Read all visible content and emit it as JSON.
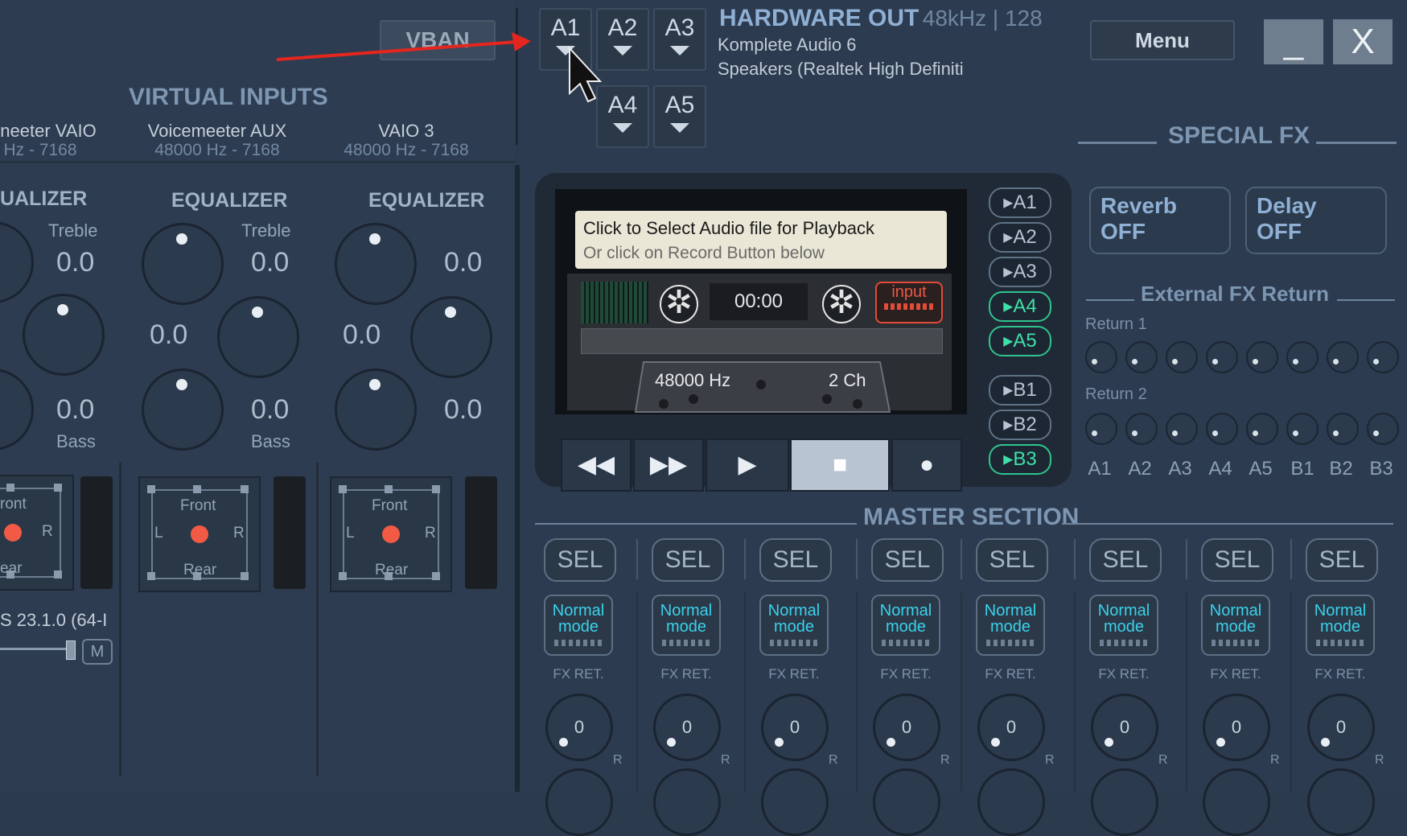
{
  "vban": {
    "label": "VBAN"
  },
  "hardware_out": {
    "title": "HARDWARE OUT",
    "rate": "48kHz | 128",
    "device1": "Komplete Audio 6",
    "device2": "Speakers (Realtek High Definiti"
  },
  "out_buttons": [
    "A1",
    "A2",
    "A3",
    "A4",
    "A5"
  ],
  "menu": {
    "label": "Menu"
  },
  "window": {
    "minimize": "_",
    "close": "X"
  },
  "virtual_inputs": {
    "title": "VIRTUAL INPUTS",
    "strips": [
      {
        "name": "neeter VAIO",
        "rate": "Hz - 7168"
      },
      {
        "name": "Voicemeeter AUX",
        "rate": "48000 Hz - 7168"
      },
      {
        "name": "VAIO 3",
        "rate": "48000 Hz - 7168"
      }
    ]
  },
  "equalizers": [
    {
      "title": "UALIZER",
      "treble_label": "Treble",
      "treble": "0.0",
      "mid": "",
      "bass": "0.0",
      "bass_label": "Bass"
    },
    {
      "title": "EQUALIZER",
      "treble_label": "Treble",
      "treble": "0.0",
      "mid": "0.0",
      "bass": "0.0",
      "bass_label": "Bass"
    },
    {
      "title": "EQUALIZER",
      "treble_label": "",
      "treble": "0.0",
      "mid": "0.0",
      "bass": "0.0",
      "bass_label": ""
    }
  ],
  "pan_pads": [
    {
      "top": "ront",
      "left": "",
      "right": "R",
      "bottom": "ear"
    },
    {
      "top": "Front",
      "left": "L",
      "right": "R",
      "bottom": "Rear"
    },
    {
      "top": "Front",
      "left": "L",
      "right": "R",
      "bottom": "Rear"
    }
  ],
  "left_footer": {
    "version": "S 23.1.0 (64-I",
    "mute": "M"
  },
  "recorder": {
    "msg1": "Click to Select Audio file for Playback",
    "msg2": "Or click on Record Button below",
    "time": "00:00",
    "input": "input",
    "rate": "48000 Hz",
    "channels": "2 Ch",
    "bus_buttons": [
      "A1",
      "A2",
      "A3",
      "A4",
      "A5",
      "B1",
      "B2",
      "B3"
    ],
    "bus_active": [
      false,
      false,
      false,
      true,
      true,
      false,
      false,
      true
    ]
  },
  "special_fx": {
    "title": "SPECIAL FX",
    "reverb": {
      "name": "Reverb",
      "state": "OFF"
    },
    "delay": {
      "name": "Delay",
      "state": "OFF"
    },
    "ext_title": "External FX Return",
    "return1": "Return 1",
    "return2": "Return 2",
    "bus_labels": [
      "A1",
      "A2",
      "A3",
      "A4",
      "A5",
      "B1",
      "B2",
      "B3"
    ]
  },
  "master": {
    "title": "MASTER SECTION",
    "sel_label": "SEL",
    "mode_line1": "Normal",
    "mode_line2": "mode",
    "fx_ret": "FX RET.",
    "knob_value": "0",
    "knob_r": "R"
  },
  "colors": {
    "accent_green": "#3fe0a8",
    "record_red": "#e24b36",
    "mode_cyan": "#3bd1e9",
    "pointer_arrow": "#e5261f"
  }
}
